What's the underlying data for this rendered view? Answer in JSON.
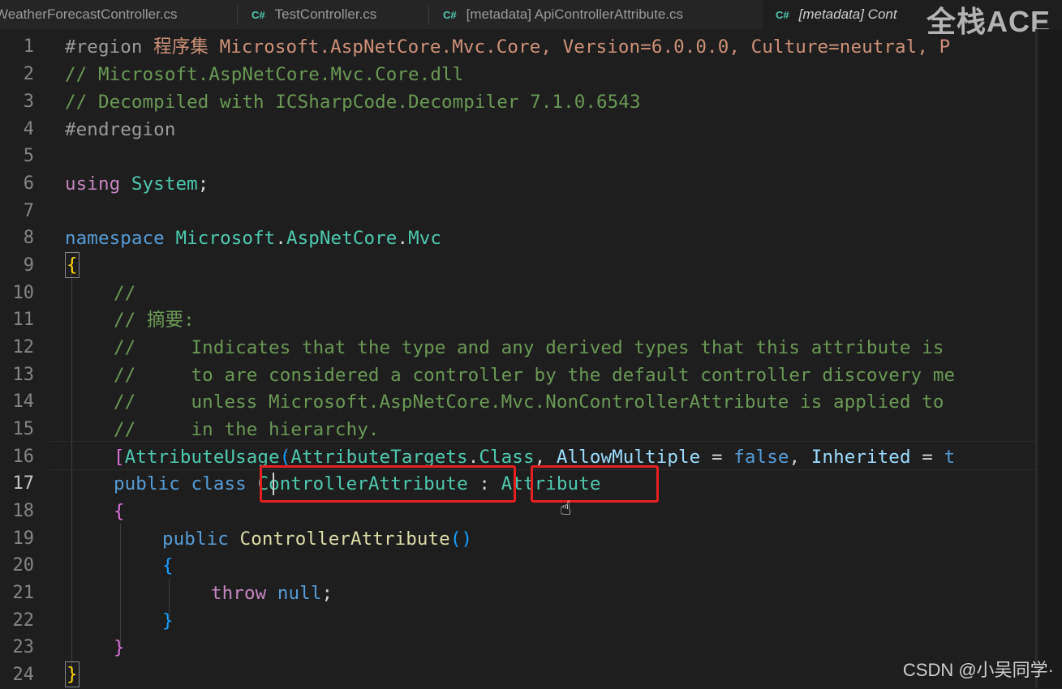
{
  "tabs": [
    {
      "label": "WeatherForecastController.cs",
      "icon": "C#"
    },
    {
      "label": "TestController.cs",
      "icon": "C#"
    },
    {
      "label": "[metadata] ApiControllerAttribute.cs",
      "icon": "C#"
    },
    {
      "label": "[metadata] Cont",
      "icon": "C#"
    }
  ],
  "overlay_logo": "全栈ACE",
  "watermark": "CSDN @小吴同学·",
  "line_numbers": [
    "1",
    "2",
    "3",
    "4",
    "5",
    "6",
    "7",
    "8",
    "9",
    "10",
    "11",
    "12",
    "13",
    "14",
    "15",
    "16",
    "17",
    "18",
    "19",
    "20",
    "21",
    "22",
    "23",
    "24"
  ],
  "code": {
    "l1_kw": "#region",
    "l1_rest": " 程序集 Microsoft.AspNetCore.Mvc.Core, Version=6.0.0.0, Culture=neutral, P",
    "l2": "// Microsoft.AspNetCore.Mvc.Core.dll",
    "l3": "// Decompiled with ICSharpCode.Decompiler 7.1.0.6543",
    "l4": "#endregion",
    "l6_kw": "using",
    "l6_ns": "System",
    "l8_kw": "namespace",
    "l8_ns1": "Microsoft",
    "l8_ns2": "AspNetCore",
    "l8_ns3": "Mvc",
    "l10": "//",
    "l11": "// 摘要:",
    "l12": "//     Indicates that the type and any derived types that this attribute is",
    "l13": "//     to are considered a controller by the default controller discovery me",
    "l14": "//     unless Microsoft.AspNetCore.Mvc.NonControllerAttribute is applied to",
    "l15": "//     in the hierarchy.",
    "l16_attr": "AttributeUsage",
    "l16_targets": "AttributeTargets",
    "l16_class": "Class",
    "l16_am": "AllowMultiple",
    "l16_false": "false",
    "l16_inh": "Inherited",
    "l16_t": "t",
    "l17_public": "public",
    "l17_class": "class",
    "l17_name": "ControllerAttribute",
    "l17_base": "Attribute",
    "l19_public": "public",
    "l19_ctor": "ControllerAttribute",
    "l21_throw": "throw",
    "l21_null": "null"
  },
  "colors": {
    "background": "#1e1e1e",
    "keyword": "#569cd6",
    "type": "#4ec9b0",
    "comment": "#6a9955",
    "highlight_box": "#e62020"
  }
}
